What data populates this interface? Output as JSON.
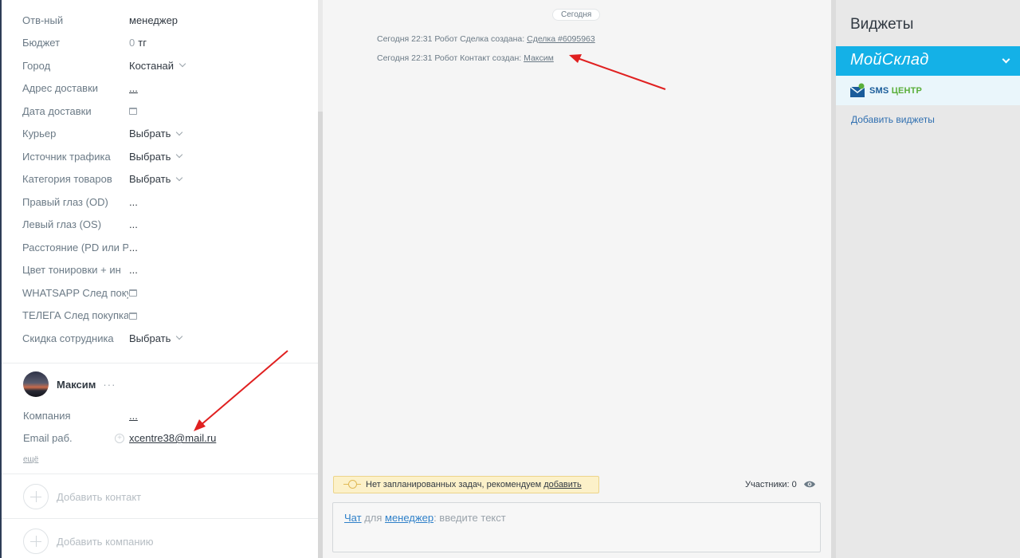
{
  "lead_fields": [
    {
      "label": "Отв-ный",
      "value": "менеджер",
      "kind": "text"
    },
    {
      "label": "Бюджет",
      "value": "0",
      "unit": "тг",
      "kind": "budget"
    },
    {
      "label": "Город",
      "value": "Костанай",
      "kind": "select"
    },
    {
      "label": "Адрес доставки",
      "value": "...",
      "kind": "link"
    },
    {
      "label": "Дата доставки",
      "value": "",
      "kind": "date"
    },
    {
      "label": "Курьер",
      "value": "Выбрать",
      "kind": "select"
    },
    {
      "label": "Источник трафика",
      "value": "Выбрать",
      "kind": "select"
    },
    {
      "label": "Категория товаров",
      "value": "Выбрать",
      "kind": "select"
    },
    {
      "label": "Правый глаз (OD)",
      "value": "...",
      "kind": "text"
    },
    {
      "label": "Левый глаз (OS)",
      "value": "...",
      "kind": "text"
    },
    {
      "label": "Расстояние (PD или Р",
      "value": "...",
      "kind": "text"
    },
    {
      "label": "Цвет тонировки + ин",
      "value": "...",
      "kind": "text"
    },
    {
      "label": "WHATSAPP След покуп",
      "value": "",
      "kind": "date"
    },
    {
      "label": "ТЕЛЕГА След покупка",
      "value": "",
      "kind": "date"
    },
    {
      "label": "Скидка сотрудника",
      "value": "Выбрать",
      "kind": "select"
    }
  ],
  "contact": {
    "name": "Максим",
    "more": "···",
    "company_label": "Компания",
    "company_value": "...",
    "email_label": "Email раб.",
    "email_value": "xcentre38@mail.ru",
    "more_link": "ещё"
  },
  "add_contact": "Добавить контакт",
  "add_company": "Добавить компанию",
  "feed": {
    "date_pill": "Сегодня",
    "events": [
      {
        "prefix": "Сегодня 22:31 Робот  Сделка создана: ",
        "link": "Сделка #6095963"
      },
      {
        "prefix": "Сегодня 22:31 Робот  Контакт создан: ",
        "link": "Максим"
      }
    ],
    "task_text": "Нет запланированных задач, рекомендуем ",
    "task_link": "добавить",
    "participants": "Участники: 0",
    "chat_link": "Чат",
    "chat_for": " для ",
    "chat_user": "менеджер",
    "chat_placeholder": ": введите текст"
  },
  "widgets": {
    "title": "Виджеты",
    "moysklad": "МойСклад",
    "sms_a": "SMS ",
    "sms_b": "ЦЕНТР",
    "add": "Добавить виджеты"
  },
  "colors": {
    "accent_blue": "#14b1e7",
    "link_blue": "#2f80c9",
    "task_yellow": "#fcf1c9",
    "annotation_red": "#e02020"
  }
}
